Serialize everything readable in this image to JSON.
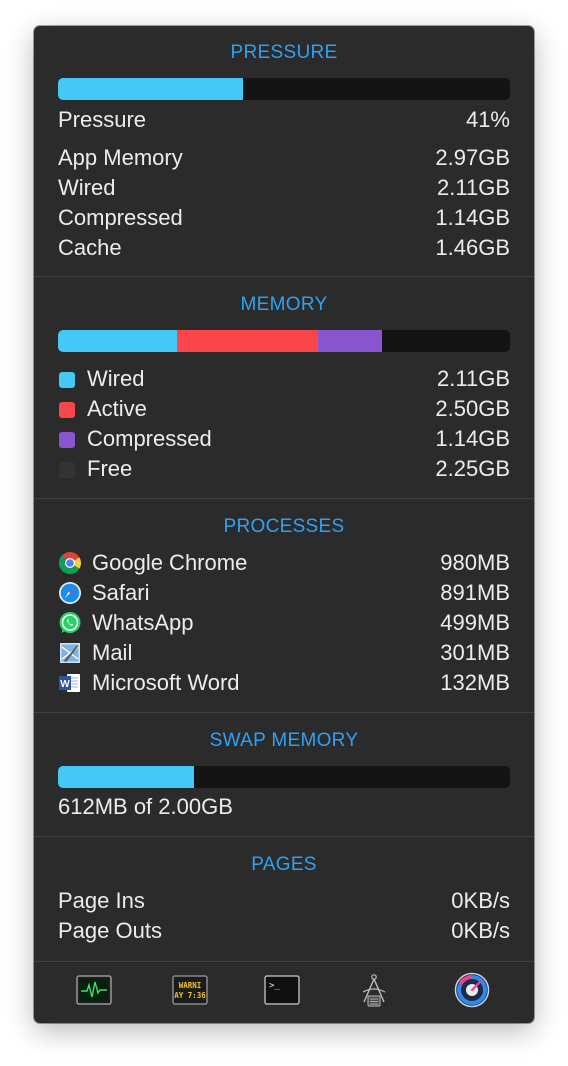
{
  "pressure": {
    "title": "PRESSURE",
    "level": 0.41,
    "label": "Pressure",
    "value": "41%",
    "stats": [
      {
        "label": "App Memory",
        "value": "2.97GB"
      },
      {
        "label": "Wired",
        "value": "2.11GB"
      },
      {
        "label": "Compressed",
        "value": "1.14GB"
      },
      {
        "label": "Cache",
        "value": "1.46GB"
      }
    ]
  },
  "memory": {
    "title": "MEMORY",
    "items": [
      {
        "label": "Wired",
        "value": "2.11GB",
        "gb": 2.11,
        "color": "#44c8f5"
      },
      {
        "label": "Active",
        "value": "2.50GB",
        "gb": 2.5,
        "color": "#f9464b"
      },
      {
        "label": "Compressed",
        "value": "1.14GB",
        "gb": 1.14,
        "color": "#8a56cf"
      },
      {
        "label": "Free",
        "value": "2.25GB",
        "gb": 2.25,
        "color": "#333333"
      }
    ]
  },
  "processes": {
    "title": "PROCESSES",
    "items": [
      {
        "label": "Google Chrome",
        "value": "980MB",
        "icon": "chrome-icon"
      },
      {
        "label": "Safari",
        "value": "891MB",
        "icon": "safari-icon"
      },
      {
        "label": "WhatsApp",
        "value": "499MB",
        "icon": "whatsapp-icon"
      },
      {
        "label": "Mail",
        "value": "301MB",
        "icon": "mail-icon"
      },
      {
        "label": "Microsoft Word",
        "value": "132MB",
        "icon": "word-icon"
      }
    ]
  },
  "swap": {
    "title": "SWAP MEMORY",
    "used_fraction": 0.3,
    "summary": "612MB of 2.00GB"
  },
  "pages": {
    "title": "PAGES",
    "items": [
      {
        "label": "Page Ins",
        "value": "0KB/s"
      },
      {
        "label": "Page Outs",
        "value": "0KB/s"
      }
    ]
  },
  "toolbar": {
    "items": [
      {
        "name": "activity-monitor-icon"
      },
      {
        "name": "console-icon",
        "text_line1": "WARNI",
        "text_line2": "AY 7:36"
      },
      {
        "name": "terminal-icon",
        "prompt": ">_"
      },
      {
        "name": "system-information-icon"
      },
      {
        "name": "istat-menus-icon"
      }
    ]
  },
  "colors": {
    "accent": "#2da2f5",
    "bar_blue": "#44c8f5",
    "panel_bg": "#2b2b2b"
  }
}
